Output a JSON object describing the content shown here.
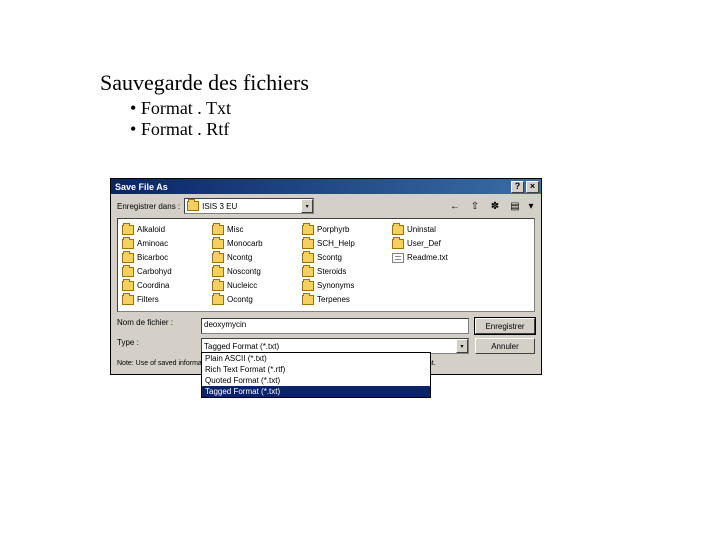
{
  "slide": {
    "title": "Sauvegarde des fichiers",
    "bullets": [
      "Format . Txt",
      "Format . Rtf"
    ]
  },
  "dialog": {
    "title": "Save File As",
    "help": "?",
    "close": "×",
    "look_in_label": "Enregistrer dans :",
    "look_in_value": "ISIS 3 EU",
    "nav": {
      "back": "←",
      "up": "⇧",
      "new_folder": "✽",
      "views": "▤",
      "views_arrow": "▾"
    },
    "files": [
      {
        "t": "folder",
        "n": "Alkaloid"
      },
      {
        "t": "folder",
        "n": "Aminoac"
      },
      {
        "t": "folder",
        "n": "Bicarboc"
      },
      {
        "t": "folder",
        "n": "Carbohyd"
      },
      {
        "t": "folder",
        "n": "Coordina"
      },
      {
        "t": "folder",
        "n": "Filters"
      },
      {
        "t": "folder",
        "n": "Misc"
      },
      {
        "t": "folder",
        "n": "Monocarb"
      },
      {
        "t": "folder",
        "n": "Ncontg"
      },
      {
        "t": "folder",
        "n": "Noscontg"
      },
      {
        "t": "folder",
        "n": "Nucleicc"
      },
      {
        "t": "folder",
        "n": "Ocontg"
      },
      {
        "t": "folder",
        "n": "Porphyrb"
      },
      {
        "t": "folder",
        "n": "SCH_Help"
      },
      {
        "t": "folder",
        "n": "Scontg"
      },
      {
        "t": "folder",
        "n": "Steroids"
      },
      {
        "t": "folder",
        "n": "Synonyms"
      },
      {
        "t": "folder",
        "n": "Terpenes"
      },
      {
        "t": "folder",
        "n": "Uninstal"
      },
      {
        "t": "folder",
        "n": "User_Def"
      },
      {
        "t": "txt",
        "n": "Readme.txt"
      }
    ],
    "filename_label": "Nom de fichier :",
    "filename_value": "deoxymycin",
    "type_label": "Type :",
    "type_value": "Tagged Format (*.txt)",
    "type_options": [
      "Plain ASCII (*.txt)",
      "Rich Text Format (*.rtf)",
      "Quoted Format (*.txt)",
      "Tagged Format (*.txt)"
    ],
    "type_selected_index": 3,
    "save_btn": "Enregistrer",
    "cancel_btn": "Annuler",
    "note": "Note: Use of saved information is subject to the use restrictions as specified in your license agreement."
  }
}
